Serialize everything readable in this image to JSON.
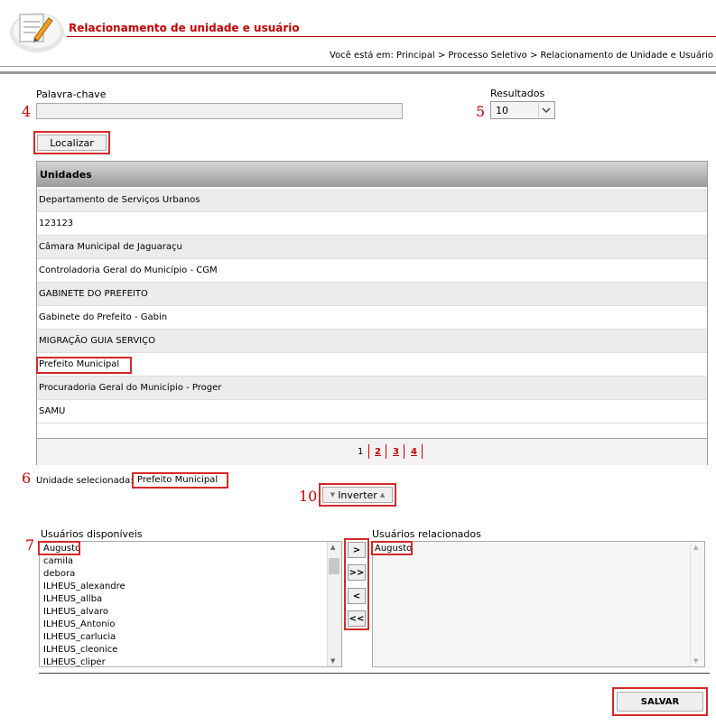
{
  "header": {
    "title": "Relacionamento de unidade e usuário",
    "breadcrumb": "Você está em: Principal > Processo Seletivo > Relacionamento de Unidade e Usuário"
  },
  "search": {
    "keyword_label": "Palavra-chave",
    "keyword_value": "",
    "results_label": "Resultados",
    "results_value": "10",
    "find_button": "Localizar"
  },
  "annotations": {
    "n4a": "4",
    "n5": "5",
    "n6": "6",
    "n7": "7",
    "n10": "10"
  },
  "table": {
    "header": "Unidades",
    "rows": [
      "Departamento de Serviços Urbanos",
      "123123",
      "Câmara Municipal de Jaguaraçu",
      "Controladoria Geral do Município - CGM",
      "GABINETE DO PREFEITO",
      "Gabinete do Prefeito - Gabin",
      "MIGRAÇÃO GUIA SERVIÇO",
      "Prefeito Municipal",
      "Procuradoria Geral do Município - Proger",
      "SAMU"
    ],
    "pages": [
      "1",
      "2",
      "3",
      "4"
    ]
  },
  "selection": {
    "label": "Unidade selecionada:",
    "value": "Prefeito Municipal",
    "invert_button": "Inverter"
  },
  "available": {
    "label": "Usuários disponíveis",
    "items": [
      "Augusto",
      "camila",
      "debora",
      "ILHEUS_alexandre",
      "ILHEUS_allba",
      "ILHEUS_alvaro",
      "ILHEUS_Antonio",
      "ILHEUS_carlucia",
      "ILHEUS_cleonice",
      "ILHEUS_cliper"
    ]
  },
  "related": {
    "label": "Usuários relacionados",
    "items": [
      "Augusto"
    ]
  },
  "move": {
    "add_one": ">",
    "add_all": ">>",
    "remove_one": "<",
    "remove_all": "<<"
  },
  "save_button": "SALVAR",
  "colors": {
    "accent": "#c40000",
    "highlight": "#d42a2a"
  }
}
